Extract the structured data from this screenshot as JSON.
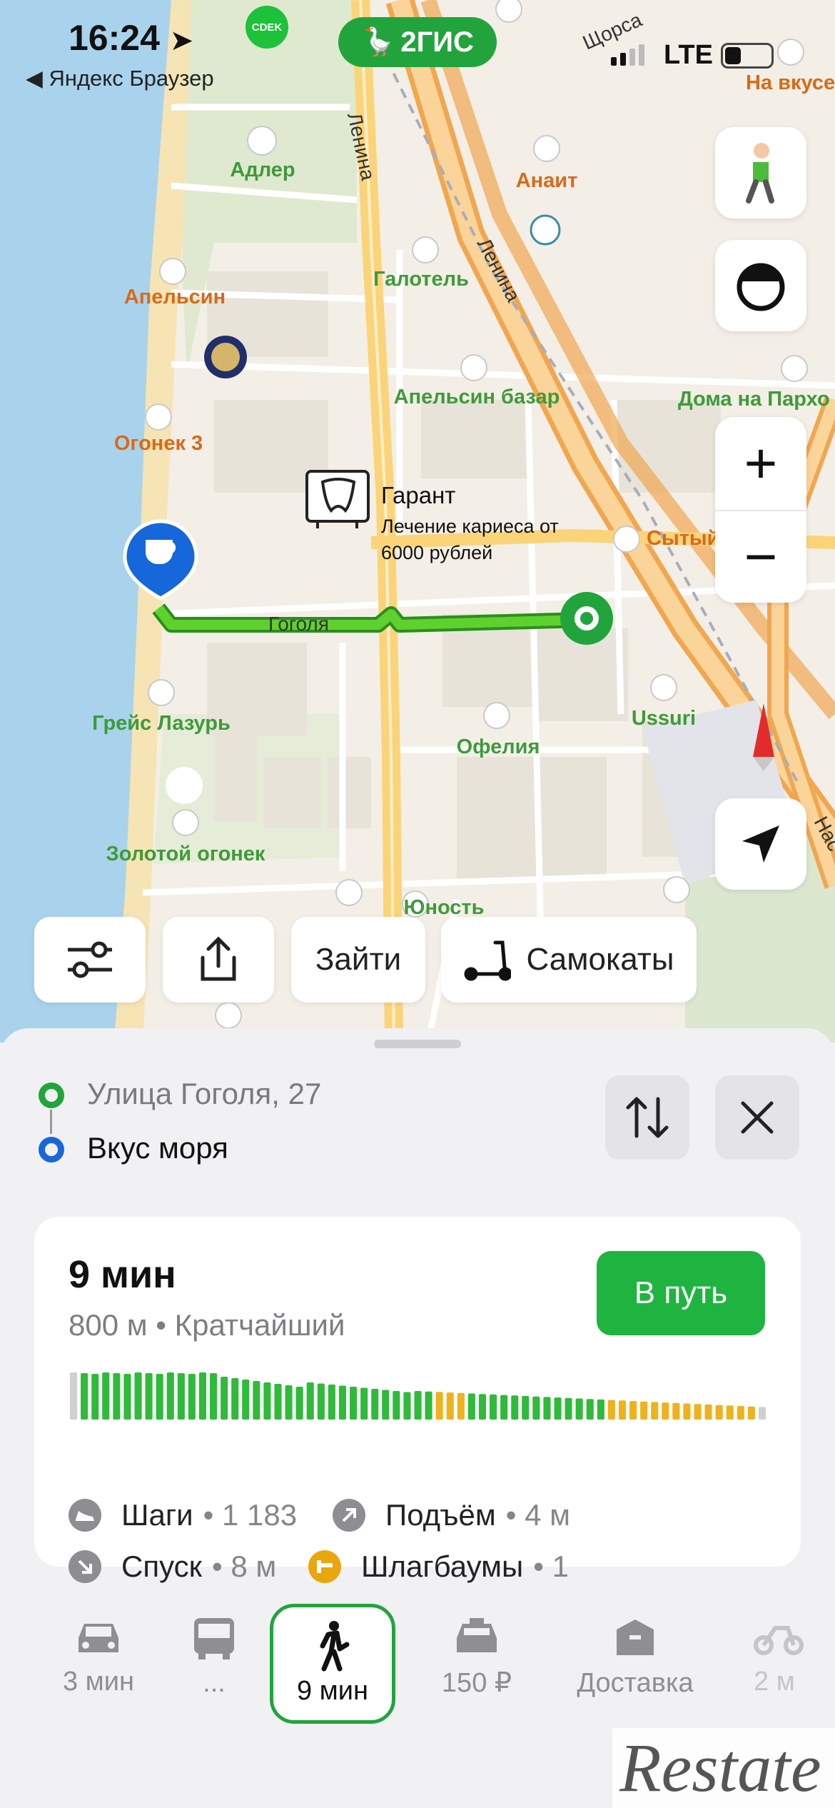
{
  "status_bar": {
    "time": "16:24",
    "back_app": "◀ Яндекс Браузер",
    "network": "LTE",
    "app_logo": "2ГИС",
    "cdek": "CDEK"
  },
  "map": {
    "streets": [
      "Ленина",
      "Ленина",
      "Щорса",
      "Гоголя",
      "Нас"
    ],
    "pois": [
      "Адлер",
      "Апельсин",
      "Огонек 3",
      "Анаит",
      "Галотель",
      "Апельсин базар",
      "Дома на Пархо",
      "На вкусе",
      "Сытый",
      "Грейс Лазурь",
      "Золотой огонек",
      "Офелия",
      "Ussuri",
      "Юность"
    ],
    "business": {
      "name": "Гарант",
      "promo_line1": "Лечение кариеса от",
      "promo_line2": "6000 рублей"
    },
    "route_color": "#41c21f"
  },
  "controls": {
    "walk_icon": "pedestrian-icon",
    "compass_icon": "compass-icon",
    "zoom_in": "+",
    "zoom_out": "−",
    "locate_icon": "location-arrow-icon"
  },
  "chips": {
    "filters_icon": "sliders-icon",
    "share_icon": "share-icon",
    "login": "Зайти",
    "scooters": "Самокаты"
  },
  "route": {
    "from": "Улица Гоголя, 27",
    "to": "Вкус моря",
    "from_color": "#22a43c",
    "to_color": "#1a66d9"
  },
  "summary": {
    "time": "9 мин",
    "sub": "800 м • Кратчайший",
    "go": "В путь",
    "elevation_profile": [
      1,
      1,
      1,
      1,
      1,
      1,
      1,
      1,
      1,
      1,
      1,
      1,
      1,
      1,
      1,
      1,
      1,
      1,
      1,
      1,
      1,
      1,
      1,
      1,
      1,
      1,
      1,
      1,
      1,
      1,
      1,
      1,
      1,
      1,
      1,
      1,
      1,
      1,
      1,
      1,
      1,
      1,
      1,
      1,
      1,
      1,
      1,
      1,
      1,
      1,
      1,
      1,
      1,
      1,
      1,
      1,
      1,
      1,
      1,
      1,
      1,
      1,
      1,
      1,
      1
    ],
    "stats": [
      {
        "label": "Шаги",
        "value": "• 1 183",
        "icon": "sneaker-icon"
      },
      {
        "label": "Подъём",
        "value": "• 4 м",
        "icon": "arrow-up-right-icon"
      },
      {
        "label": "Спуск",
        "value": "• 8 м",
        "icon": "arrow-down-right-icon"
      },
      {
        "label": "Шлагбаумы",
        "value": "• 1",
        "icon": "barrier-icon"
      }
    ]
  },
  "modes": [
    {
      "label": "3 мин",
      "icon": "car-icon"
    },
    {
      "label": "...",
      "icon": "bus-icon"
    },
    {
      "label": "9 мин",
      "icon": "pedestrian-icon",
      "selected": true
    },
    {
      "label": "150 ₽",
      "icon": "taxi-icon"
    },
    {
      "label": "Доставка",
      "icon": "box-icon"
    },
    {
      "label": "2 м",
      "icon": "bike-icon"
    }
  ],
  "watermark": "Restate"
}
